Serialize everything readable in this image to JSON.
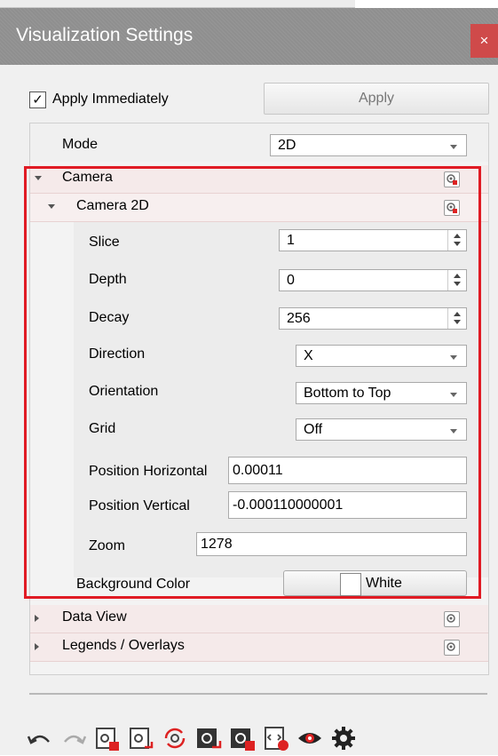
{
  "window": {
    "title": "Visualization Settings",
    "close_glyph": "×"
  },
  "top": {
    "apply_immediately_label": "Apply Immediately",
    "apply_immediately_checked": true,
    "apply_button": "Apply"
  },
  "tree": {
    "mode": {
      "label": "Mode",
      "value": "2D"
    },
    "camera": {
      "label": "Camera"
    },
    "camera2d": {
      "label": "Camera 2D"
    },
    "slice": {
      "label": "Slice",
      "value": "1"
    },
    "depth": {
      "label": "Depth",
      "value": "0"
    },
    "decay": {
      "label": "Decay",
      "value": "256"
    },
    "direction": {
      "label": "Direction",
      "value": "X"
    },
    "orientation": {
      "label": "Orientation",
      "value": "Bottom to Top"
    },
    "grid": {
      "label": "Grid",
      "value": "Off"
    },
    "pos_h": {
      "label": "Position Horizontal",
      "value": "0.00011"
    },
    "pos_v": {
      "label": "Position Vertical",
      "value": "-0.000110000001"
    },
    "zoom": {
      "label": "Zoom",
      "value": "1278"
    },
    "background": {
      "label": "Background Color",
      "value": "White",
      "color": "#ffffff"
    },
    "data_view": {
      "label": "Data View"
    },
    "legends": {
      "label": "Legends / Overlays"
    }
  },
  "colors": {
    "title_bar": "#8f8f8f",
    "close": "#cf4a4a",
    "highlight": "#e01b24",
    "category_bg": "#f5eaea"
  },
  "toolbar": [
    "undo-icon",
    "redo-icon",
    "save-settings-icon",
    "load-settings-icon",
    "sync-settings-icon",
    "export-icon",
    "import-icon",
    "script-record-icon",
    "eye-icon",
    "gear-icon"
  ]
}
